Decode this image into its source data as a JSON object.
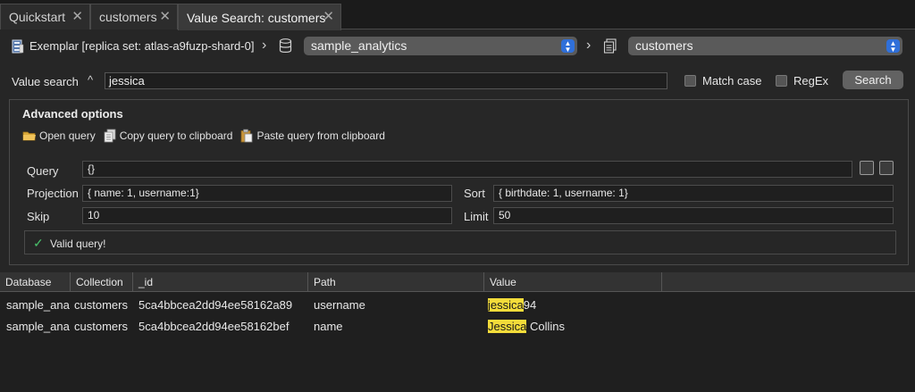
{
  "tabs": [
    {
      "label": "Quickstart"
    },
    {
      "label": "customers"
    },
    {
      "label": "Value Search: customers"
    }
  ],
  "connection": {
    "label": "Exemplar [replica set: atlas-a9fuzp-shard-0]",
    "database": "sample_analytics",
    "collection": "customers"
  },
  "value_search": {
    "label": "Value search",
    "query": "jessica",
    "match_case_label": "Match case",
    "match_case_checked": false,
    "regex_label": "RegEx",
    "regex_checked": false,
    "search_label": "Search"
  },
  "advanced": {
    "title": "Advanced options",
    "open_query_label": "Open query",
    "copy_query_label": "Copy query to clipboard",
    "paste_query_label": "Paste query from clipboard",
    "query_label": "Query",
    "query_value": "{}",
    "projection_label": "Projection",
    "projection_value": "{ name: 1, username:1}",
    "sort_label": "Sort",
    "sort_value": "{ birthdate: 1, username: 1}",
    "skip_label": "Skip",
    "skip_value": "10",
    "limit_label": "Limit",
    "limit_value": "50",
    "valid_message": "Valid query!"
  },
  "results": {
    "columns": [
      "Database",
      "Collection",
      "_id",
      "Path",
      "Value"
    ],
    "rows": [
      {
        "database": "sample_ana",
        "collection": "customers",
        "id": "5ca4bbcea2dd94ee58162a89",
        "path": "username",
        "value_match": "jessica",
        "value_rest": "94"
      },
      {
        "database": "sample_ana",
        "collection": "customers",
        "id": "5ca4bbcea2dd94ee58162bef",
        "path": "name",
        "value_match": "Jessica",
        "value_rest": " Collins"
      }
    ]
  },
  "colors": {
    "accent": "#2f6fd9",
    "highlight": "#f3dc3a",
    "valid": "#49c26b"
  }
}
